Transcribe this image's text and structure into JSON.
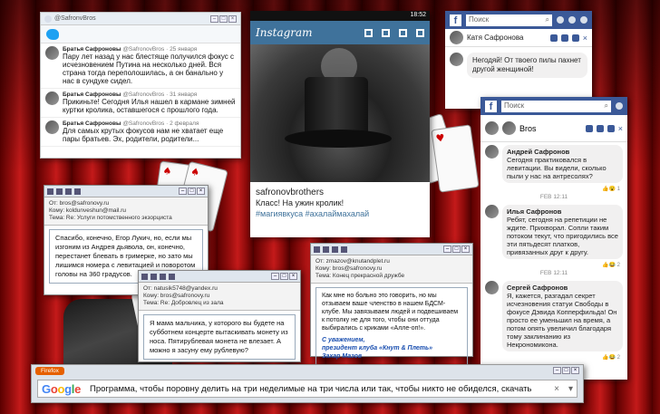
{
  "twitter": {
    "handle": "@SafronvBros",
    "posts": [
      {
        "name": "Братья Сафроновы",
        "meta": "@SafronovBros · 25 января",
        "text": "Пару лет назад у нас блестяще получился фокус с исчезновением Путина на несколько дней. Вся страна тогда переполошилась, а он банально у нас в сундуке сидел."
      },
      {
        "name": "Братья Сафроновы",
        "meta": "@SafronovBros · 31 января",
        "text": "Прикиньте! Сегодня Илья нашел в кармане зимней куртки кролика, оставшегося с прошлого года."
      },
      {
        "name": "Братья Сафроновы",
        "meta": "@SafronovBros · 2 февраля",
        "text": "Для самых крутых фокусов нам не хватает еще пары братьев. Эх, родители, родители..."
      }
    ]
  },
  "instagram": {
    "time": "18:52",
    "logo": "Instagram",
    "username": "safronovbrothers",
    "caption": "Класс! На ужин кролик!",
    "tags": "#магиявкуса #ахалаймахалай"
  },
  "facebook1": {
    "search": "Поиск",
    "contact": "Катя Сафронова",
    "message": "Негодяй! От твоего пилы пахнет другой женщиной!"
  },
  "facebook2": {
    "search": "Поиск",
    "chat_title": "Bros",
    "messages": [
      {
        "author": "Андрей Сафронов",
        "text": "Сегодня практиковался в левитации. Вы видели, сколько пыли у нас на антресолях?",
        "react": "1"
      },
      {
        "date": "FEB 12:11"
      },
      {
        "author": "Илья Сафронов",
        "text": "Ребят, сегодня на репетиции не ждите. Прихворал. Сопли таким потоком текут, что пригодились все эти пятьдесят платков, привязанных друг к другу.",
        "react": "2"
      },
      {
        "date": "FEB 12:11"
      },
      {
        "author": "Сергей Сафронов",
        "text": "Я, кажется, разгадал секрет исчезновения статуи Свободы в фокусе Дэвида Копперфильда! Он просто ее уменьшил на время, а потом опять увеличил благодаря тому заклинанию из Некрономикона.",
        "react": "2"
      }
    ]
  },
  "mail1": {
    "from": "От: bros@safronovy.ru",
    "to": "Кому: koldunveshun@mail.ru",
    "subject": "Тема: Re: Услуги потомственного экзорциста",
    "body": "Спасибо, конечно, Егор Лукич, но, если мы изгоним из Андрея дьявола, он, конечно, перестанет блевать в гримерке, но зато мы лишимся номера с левитацией и поворотом головы на 360 градусов."
  },
  "mail2": {
    "from": "От: natusik5748@yandex.ru",
    "to": "Кому: bros@safronovy.ru",
    "subject": "Тема: Re: Добровлец из зала",
    "body": "Я мама мальчика, у которого вы будете на субботнем концерте вытаскивать монету из носа. Пятирублевая монета не влезает. А можно я засуну ему рублевую?"
  },
  "mail3": {
    "from": "От: zmazov@knutandplet.ru",
    "to": "Кому: bros@safronovy.ru",
    "subject": "Тема: Конец прекрасной дружбе",
    "body": "Как мне но больно это говорить, но мы отзываем ваше членство в нашем БДСМ-клубе. Мы завязываем людей и подвешиваем к потолку не для того, чтобы они оттуда выбирались с криками «Алле-оп!».",
    "signature": [
      "С уважением,",
      "президент клуба «Кнут & Плеть»",
      "Захар Мазов"
    ]
  },
  "firefox": {
    "tab": "Firefox",
    "query": "Программа, чтобы поровну делить на три неделимые на три числа или так, чтобы никто не обиделся, скачать"
  },
  "colors": {
    "facebook": "#3b5998",
    "twitter": "#1da1f2",
    "instagram": "#3f729b",
    "firefox": "#e66000"
  }
}
